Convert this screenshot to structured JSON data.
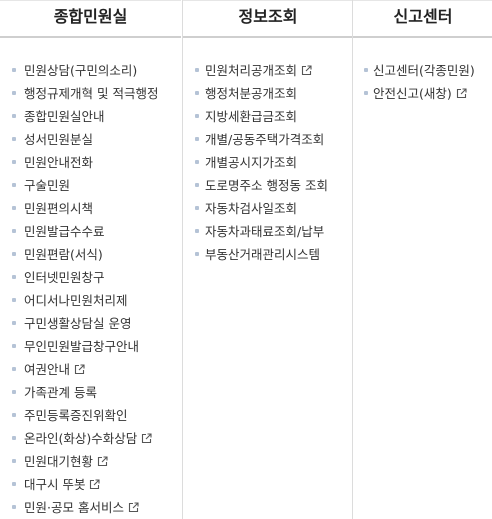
{
  "columns": [
    {
      "title": "종합민원실",
      "items": [
        {
          "label": "민원상담(구민의소리)",
          "external": false
        },
        {
          "label": "행정규제개혁 및 적극행정",
          "external": false
        },
        {
          "label": "종합민원실안내",
          "external": false
        },
        {
          "label": "성서민원분실",
          "external": false
        },
        {
          "label": "민원안내전화",
          "external": false
        },
        {
          "label": "구술민원",
          "external": false
        },
        {
          "label": "민원편의시책",
          "external": false
        },
        {
          "label": "민원발급수수료",
          "external": false
        },
        {
          "label": "민원편람(서식)",
          "external": false
        },
        {
          "label": "인터넷민원창구",
          "external": false
        },
        {
          "label": "어디서나민원처리제",
          "external": false
        },
        {
          "label": "구민생활상담실 운영",
          "external": false
        },
        {
          "label": "무인민원발급창구안내",
          "external": false
        },
        {
          "label": "여권안내",
          "external": true
        },
        {
          "label": "가족관계 등록",
          "external": false
        },
        {
          "label": "주민등록증진위확인",
          "external": false
        },
        {
          "label": "온라인(화상)수화상담",
          "external": true
        },
        {
          "label": "민원대기현황",
          "external": true
        },
        {
          "label": "대구시 뚜봇",
          "external": true
        },
        {
          "label": "민원·공모 홈서비스",
          "external": true
        }
      ]
    },
    {
      "title": "정보조회",
      "items": [
        {
          "label": "민원처리공개조회",
          "external": true
        },
        {
          "label": "행정처분공개조회",
          "external": false
        },
        {
          "label": "지방세환급금조회",
          "external": false
        },
        {
          "label": "개별/공동주택가격조회",
          "external": false
        },
        {
          "label": "개별공시지가조회",
          "external": false
        },
        {
          "label": "도로명주소 행정동 조회",
          "external": false
        },
        {
          "label": "자동차검사일조회",
          "external": false
        },
        {
          "label": "자동차과태료조회/납부",
          "external": false
        },
        {
          "label": "부동산거래관리시스템",
          "external": false
        }
      ]
    },
    {
      "title": "신고센터",
      "items": [
        {
          "label": "신고센터(각종민원)",
          "external": false
        },
        {
          "label": "안전신고(새창)",
          "external": true
        }
      ]
    }
  ],
  "icons": {
    "bullet": "square-bullet-icon",
    "external": "external-link-icon"
  },
  "colors": {
    "bullet": "#b5c3d6",
    "divider": "#dcdcdc",
    "text": "#333333",
    "heading": "#222222"
  }
}
